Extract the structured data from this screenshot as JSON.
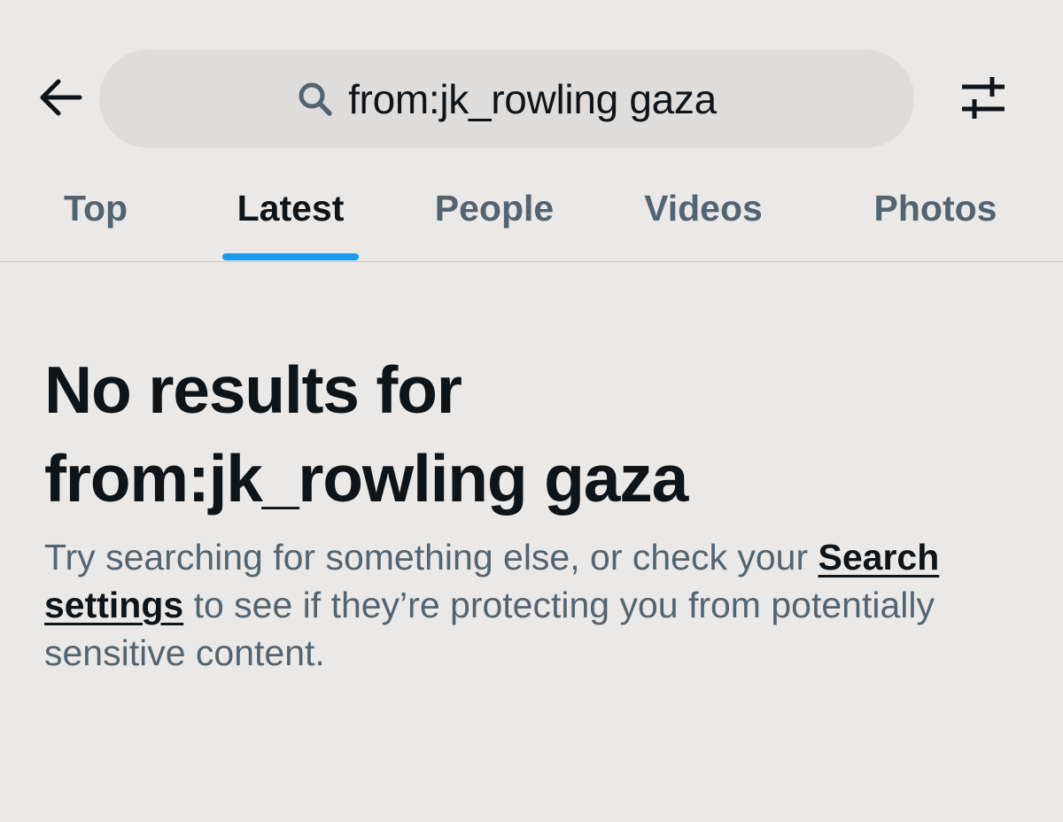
{
  "header": {
    "back_icon": "arrow-left-icon",
    "search": {
      "icon": "search-icon",
      "query": "from:jk_rowling gaza"
    },
    "filter_icon": "sliders-icon"
  },
  "tabs": [
    {
      "label": "Top",
      "active": false
    },
    {
      "label": "Latest",
      "active": true
    },
    {
      "label": "People",
      "active": false
    },
    {
      "label": "Videos",
      "active": false
    },
    {
      "label": "Photos",
      "active": false
    }
  ],
  "empty_state": {
    "title_line1": "No results for",
    "title_line2": "from:jk_rowling gaza",
    "desc_before": "Try searching for something else, or check your ",
    "desc_link": "Search settings",
    "desc_after": " to see if they’re protecting you from potentially sensitive content."
  },
  "colors": {
    "background": "#ebe9e7",
    "search_pill": "#dfdddb",
    "accent": "#1d9bf0",
    "primary_text": "#0f1419",
    "secondary_text": "#536471"
  }
}
